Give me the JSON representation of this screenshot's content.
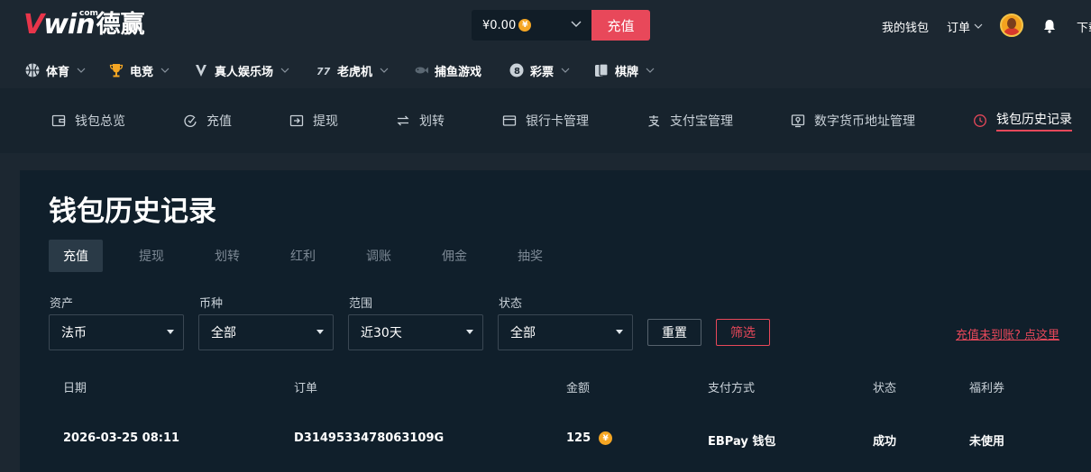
{
  "header": {
    "logo_brand": "Vwin",
    "logo_com": "com",
    "logo_cn": "德赢",
    "balance": "¥0.00",
    "balance_coin": "¥",
    "deposit_label": "充值",
    "wallet_label": "我的钱包",
    "orders_label": "订单",
    "download_label": "下载"
  },
  "game_nav": [
    {
      "label": "体育",
      "icon": "basketball-icon"
    },
    {
      "label": "电竞",
      "icon": "trophy-icon"
    },
    {
      "label": "真人娱乐场",
      "icon": "dealer-icon"
    },
    {
      "label": "老虎机",
      "icon": "slot-777-icon"
    },
    {
      "label": "捕鱼游戏",
      "icon": "fish-icon"
    },
    {
      "label": "彩票",
      "icon": "lottery-ball-icon"
    },
    {
      "label": "棋牌",
      "icon": "cards-icon"
    }
  ],
  "wallet_nav": [
    {
      "label": "钱包总览",
      "icon": "wallet-icon"
    },
    {
      "label": "充值",
      "icon": "deposit-icon"
    },
    {
      "label": "提现",
      "icon": "withdraw-icon"
    },
    {
      "label": "划转",
      "icon": "transfer-icon"
    },
    {
      "label": "银行卡管理",
      "icon": "bank-card-icon"
    },
    {
      "label": "支付宝管理",
      "icon": "alipay-icon"
    },
    {
      "label": "数字货币地址管理",
      "icon": "crypto-address-icon"
    },
    {
      "label": "钱包历史记录",
      "icon": "history-clock-icon",
      "active": true
    }
  ],
  "page": {
    "title": "钱包历史记录",
    "tabs": [
      "充值",
      "提现",
      "划转",
      "红利",
      "调账",
      "佣金",
      "抽奖"
    ],
    "active_tab": "充值"
  },
  "filters": {
    "asset": {
      "label": "资产",
      "value": "法币"
    },
    "currency": {
      "label": "币种",
      "value": "全部"
    },
    "range": {
      "label": "范围",
      "value": "近30天"
    },
    "status": {
      "label": "状态",
      "value": "全部"
    },
    "reset_label": "重置",
    "filter_label": "筛选",
    "help_link": "充值未到账? 点这里"
  },
  "table": {
    "columns": [
      "日期",
      "订单",
      "金额",
      "支付方式",
      "状态",
      "福利券"
    ],
    "rows": [
      {
        "date": "2026-03-25 08:11",
        "order": "D3149533478063109G",
        "amount": "125",
        "coin": "¥",
        "method": "EBPay 钱包",
        "status": "成功",
        "coupon": "未使用"
      }
    ]
  },
  "colors": {
    "accent": "#e8485a",
    "coin": "#f5a623",
    "background": "#1c2731",
    "panel": "#101f2b"
  }
}
